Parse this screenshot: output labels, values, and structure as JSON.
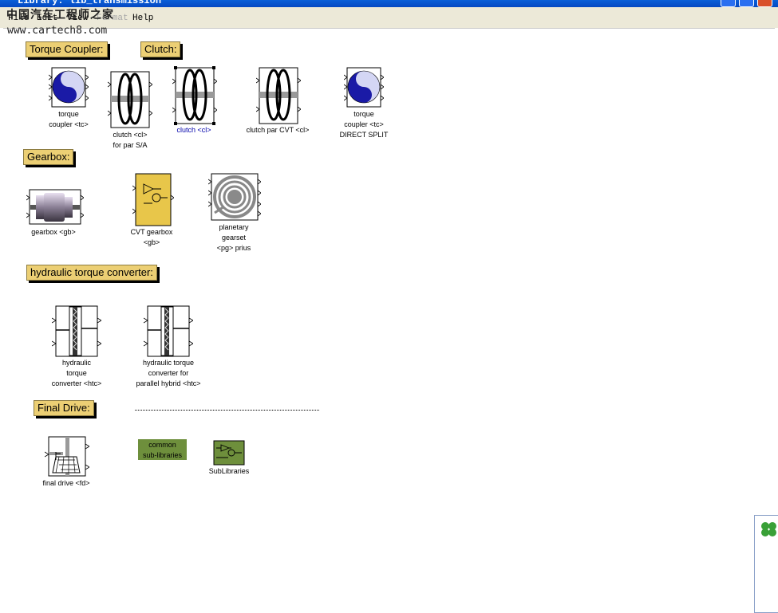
{
  "window": {
    "title": "Library: lib_transmission"
  },
  "menubar": {
    "items": [
      "File",
      "Edit",
      "View",
      "Format",
      "Help"
    ]
  },
  "watermark": {
    "cn": "中国汽车工程师之家",
    "url": "www.cartech8.com"
  },
  "sections": {
    "torque_coupler": "Torque Coupler:",
    "clutch": "Clutch:",
    "gearbox": "Gearbox:",
    "htc": "hydraulic torque converter:",
    "final_drive": "Final Drive:"
  },
  "blocks": {
    "torque_coupler_1": "torque\ncoupler <tc>",
    "clutch_par_sa": "clutch <cl>\nfor par S/A",
    "clutch_cl": "clutch <cl>",
    "clutch_par_cvt": "clutch par CVT <cl>",
    "torque_coupler_direct": "torque\ncoupler <tc>\nDIRECT SPLIT",
    "gearbox_gb": "gearbox <gb>",
    "cvt_gearbox": "CVT gearbox\n<gb>",
    "planetary": "planetary\ngearset\n<pg> prius",
    "htc_1": "hydraulic\ntorque\nconverter <htc>",
    "htc_parallel": "hydraulic torque\nconverter for\nparallel hybrid <htc>",
    "final_drive": "final drive <fd>",
    "common_sublib": "common\nsub-libraries",
    "sublibraries": "SubLibraries"
  },
  "colors": {
    "header_fill": "#eccf74",
    "cvt_fill": "#e8c64a",
    "sublib_fill": "#6e8f3c",
    "selection": "#0000aa"
  }
}
